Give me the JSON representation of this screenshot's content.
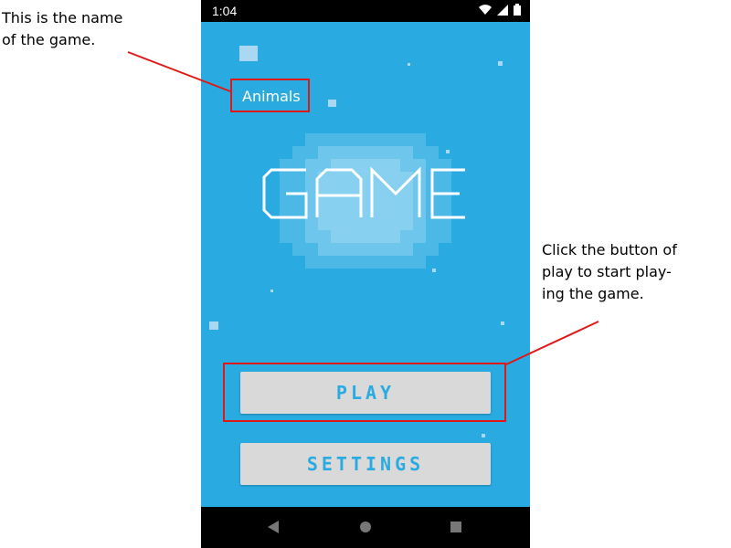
{
  "annotations": {
    "name_note": "This is the name\nof the game.",
    "play_note": "Click the button of\nplay to start play-\ning the game."
  },
  "status_bar": {
    "time": "1:04",
    "icons": [
      "wifi-icon",
      "signal-icon",
      "battery-icon"
    ]
  },
  "app": {
    "game_name": "Animals",
    "title": "GAME",
    "play_label": "PLAY",
    "settings_label": "SETTINGS"
  },
  "nav_bar": {
    "icons": [
      "back-icon",
      "home-icon",
      "recents-icon"
    ]
  },
  "colors": {
    "background": "#29abe2",
    "button": "#d9d9d9",
    "button_text": "#29abe2",
    "annotation": "#e01818"
  }
}
